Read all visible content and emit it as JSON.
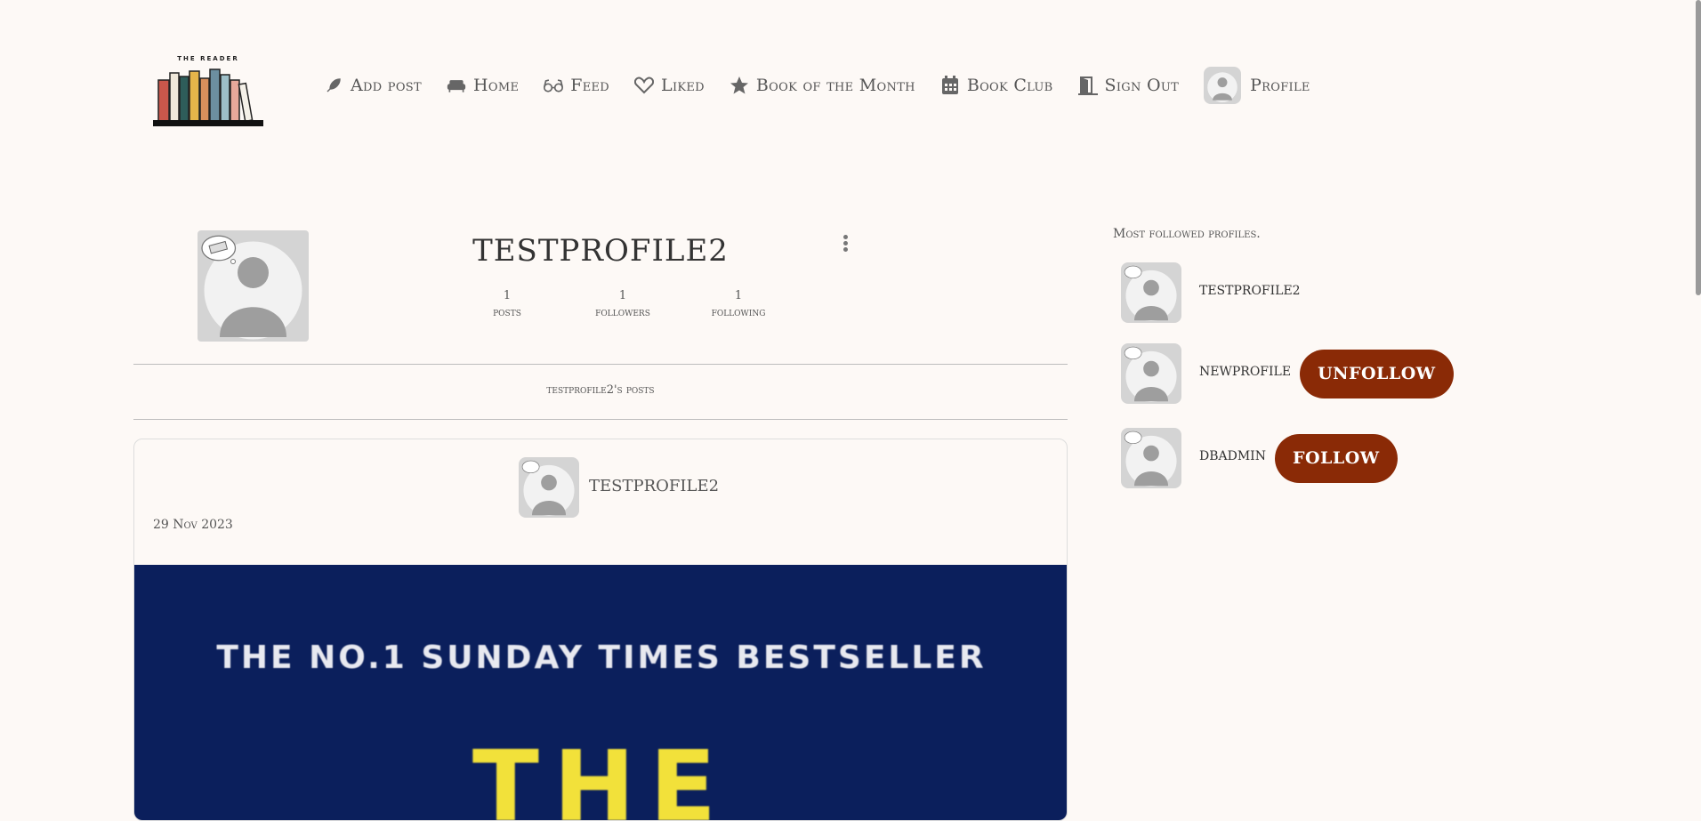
{
  "brand": {
    "logo_text": "THE READER"
  },
  "nav": {
    "items": [
      {
        "label": "Add post",
        "icon": "feather-pen-icon"
      },
      {
        "label": "Home",
        "icon": "couch-icon"
      },
      {
        "label": "Feed",
        "icon": "glasses-icon"
      },
      {
        "label": "Liked",
        "icon": "heart-icon"
      },
      {
        "label": "Book of the Month",
        "icon": "star-icon"
      },
      {
        "label": "Book Club",
        "icon": "calendar-icon"
      },
      {
        "label": "Sign Out",
        "icon": "door-open-icon"
      },
      {
        "label": "Profile",
        "icon": "avatar"
      }
    ]
  },
  "profile": {
    "name": "TESTPROFILE2",
    "stats": [
      {
        "value": "1",
        "label": "posts"
      },
      {
        "value": "1",
        "label": "followers"
      },
      {
        "value": "1",
        "label": "following"
      }
    ],
    "posts_heading": "testprofile2's posts"
  },
  "post": {
    "owner": "TESTPROFILE2",
    "date": "29 Nov 2023",
    "image_text_line1": "THE NO.1 SUNDAY TIMES BESTSELLER",
    "image_text_line2": "THE"
  },
  "sidebar": {
    "title": "Most followed profiles.",
    "profiles": [
      {
        "name": "TESTPROFILE2",
        "button": ""
      },
      {
        "name": "NEWPROFILE",
        "button": "UNFOLLOW"
      },
      {
        "name": "DBADMIN",
        "button": "FOLLOW"
      }
    ]
  },
  "colors": {
    "background": "#fdf9f6",
    "button": "#8a2a06",
    "post_image_bg": "#0b1f5c",
    "post_image_title": "#f2e13a"
  }
}
